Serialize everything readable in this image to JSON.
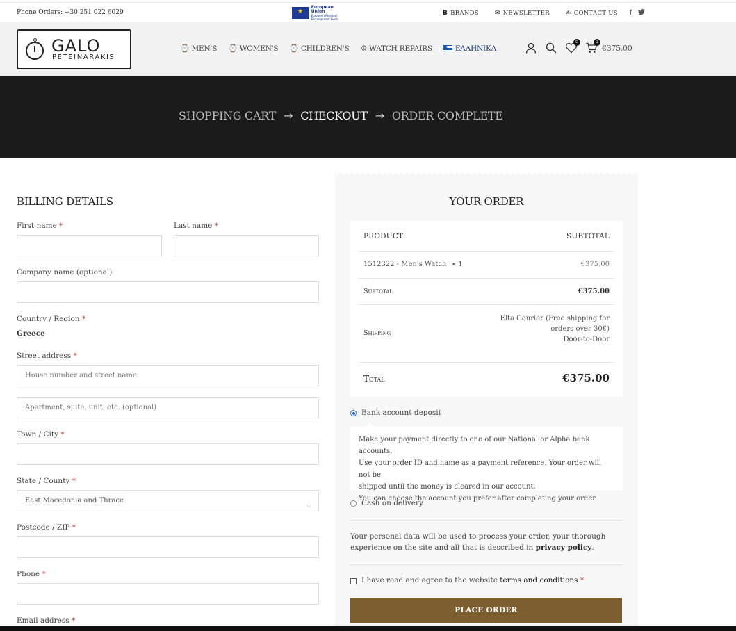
{
  "topbar": {
    "phone": "Phone Orders: +30 251 022 6029",
    "eu_text_line1": "European Union",
    "eu_text_line2": "European Regional",
    "eu_text_line3": "Development Fund",
    "nav": [
      {
        "label": "BRANDS",
        "icon": "B"
      },
      {
        "label": "NEWSLETTER",
        "icon": "✉"
      },
      {
        "label": "CONTACT US",
        "icon": "✍"
      }
    ],
    "social": [
      "f",
      "🐦"
    ]
  },
  "header": {
    "logo_name": "GALO",
    "logo_sub": "PETEINARAKIS",
    "nav": [
      {
        "label": "MEN'S",
        "icon": "⌚"
      },
      {
        "label": "WOMEN'S",
        "icon": "⌚"
      },
      {
        "label": "CHILDREN'S",
        "icon": "⌚"
      },
      {
        "label": "WATCH REPAIRS",
        "icon": "⚙"
      },
      {
        "label": "ΕΛΛΗΝΙΚΑ",
        "icon": "flag-greece"
      }
    ],
    "wishlist_count": "0",
    "cart_count": "1",
    "cart_total": "€375.00"
  },
  "steps": {
    "cart": "SHOPPING CART",
    "checkout": "CHECKOUT",
    "complete": "ORDER COMPLETE",
    "arrow": "→"
  },
  "billing": {
    "title": "BILLING DETAILS",
    "first_name_label": "First name",
    "last_name_label": "Last name",
    "company_label": "Company name (optional)",
    "country_label": "Country / Region",
    "country_value": "Greece",
    "street_label": "Street address",
    "street_placeholder": "House number and street name",
    "apartment_placeholder": "Apartment, suite, unit, etc. (optional)",
    "town_label": "Town / City",
    "state_label": "State / County",
    "state_value": "East Macedonia and Thrace",
    "postcode_label": "Postcode / ZIP",
    "phone_label": "Phone",
    "email_label": "Email address",
    "required_mark": "*"
  },
  "order": {
    "title": "YOUR ORDER",
    "col_product": "PRODUCT",
    "col_subtotal": "SUBTOTAL",
    "item_name": "1512322 - Men's Watch",
    "item_qty": "× 1",
    "item_price": "€375.00",
    "subtotal_label": "Subtotal",
    "subtotal_value": "€375.00",
    "shipping_label": "Shipping",
    "shipping_line1": "Elta Courier (Free shipping for",
    "shipping_line2": "orders over 30€)",
    "shipping_line3": "Door-to-Door",
    "total_label": "Total",
    "total_value": "€375.00"
  },
  "payment": {
    "bank_label": "Bank account deposit",
    "bank_selected": true,
    "bank_desc_line1": "Make your payment directly to one of our National or Alpha bank accounts.",
    "bank_desc_line2": "Use your order ID and name as a payment reference. Your order will not be",
    "bank_desc_line3": "shipped until the money is cleared in our account.",
    "bank_desc_line4": "You can choose the account you prefer after completing your order",
    "cod_label": "Cash on delivery",
    "privacy_text": "Your personal data will be used to process your order, your thorough experience on the site and all that is described in",
    "privacy_link": "privacy policy",
    "terms_text": "I have read and agree to the website",
    "terms_link": "terms and conditions",
    "place_order": "PLACE ORDER",
    "accent_color": "#7d5f2f"
  }
}
